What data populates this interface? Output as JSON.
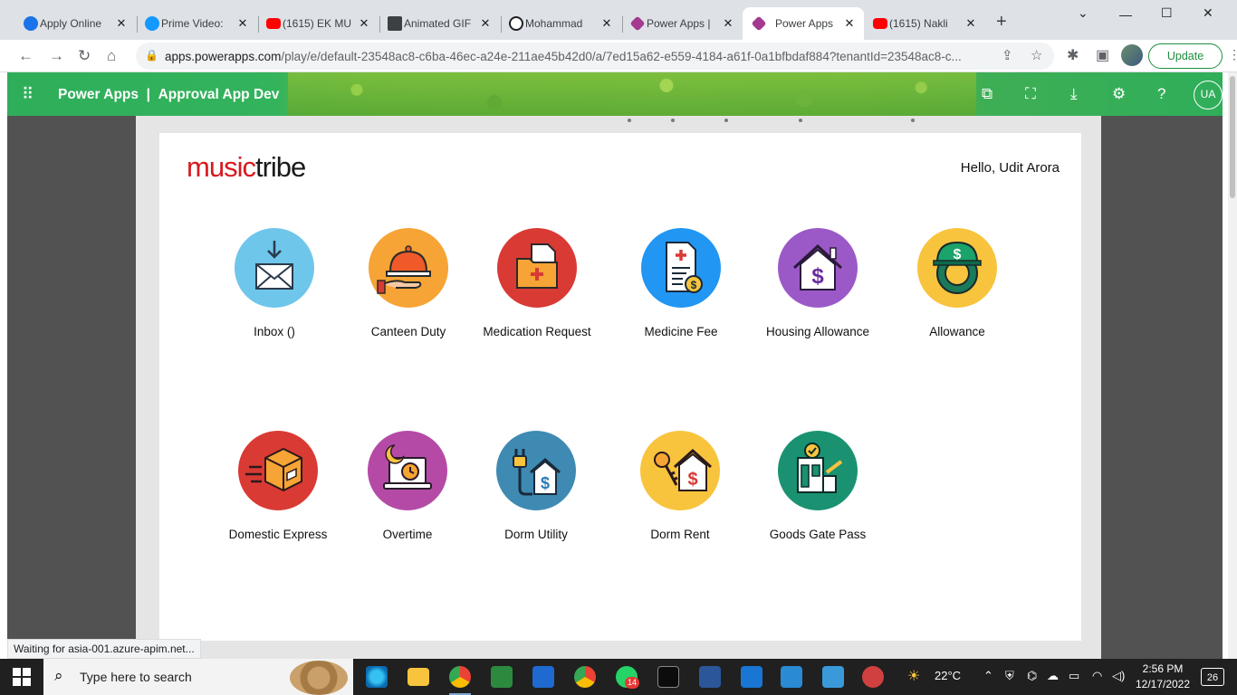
{
  "browser": {
    "tabs": [
      {
        "label": "Apply Online",
        "favicon_color": "#1a73e8"
      },
      {
        "label": "Prime Video:",
        "favicon_color": "#1399ff"
      },
      {
        "label": "(1615) EK MU",
        "favicon_color": "#ff0000"
      },
      {
        "label": "Animated GIF",
        "favicon_color": "#3c4043"
      },
      {
        "label": "Mohammad",
        "favicon_color": "#202124"
      },
      {
        "label": "Power Apps |",
        "favicon_color": "#a33a8f"
      },
      {
        "label": "Power Apps",
        "favicon_color": "#a33a8f",
        "active": true
      },
      {
        "label": "(1615) Nakli",
        "favicon_color": "#ff0000"
      }
    ],
    "url_host": "apps.powerapps.com",
    "url_path": "/play/e/default-23548ac8-c6ba-46ec-a24e-211ae45b42d0/a/7ed15a62-e559-4184-a61f-0a1bfbdaf884?tenantId=23548ac8-c...",
    "update_label": "Update",
    "status_text": "Waiting for asia-001.azure-apim.net..."
  },
  "powerapps": {
    "brand": "Power Apps",
    "separator": "|",
    "app_name": "Approval App Dev",
    "user_initials": "UA"
  },
  "app": {
    "logo_music": "music",
    "logo_tribe": "tribe",
    "greeting": "Hello, Udit Arora",
    "tiles": [
      {
        "label": "Inbox ()",
        "icon": "inbox-icon",
        "color": "#6ec6ea"
      },
      {
        "label": "Canteen Duty",
        "icon": "canteen-duty-icon",
        "color": "#f6a435"
      },
      {
        "label": "Medication Request",
        "icon": "medication-request-icon",
        "color": "#d93a34"
      },
      {
        "label": "Medicine Fee",
        "icon": "medicine-fee-icon",
        "color": "#2196f3"
      },
      {
        "label": "Housing Allowance",
        "icon": "housing-allowance-icon",
        "color": "#9b59c7"
      },
      {
        "label": "Allowance",
        "icon": "allowance-icon",
        "color": "#f8c43d"
      },
      {
        "label": "Domestic Express",
        "icon": "domestic-express-icon",
        "color": "#d93a34"
      },
      {
        "label": "Overtime",
        "icon": "overtime-icon",
        "color": "#b54aa6"
      },
      {
        "label": "Dorm Utility",
        "icon": "dorm-utility-icon",
        "color": "#3f8ab3"
      },
      {
        "label": "Dorm Rent",
        "icon": "dorm-rent-icon",
        "color": "#f8c43d"
      },
      {
        "label": "Goods Gate Pass",
        "icon": "goods-gate-pass-icon",
        "color": "#1a9272"
      }
    ]
  },
  "taskbar": {
    "search_placeholder": "Type here to search",
    "weather": "22°C",
    "time": "2:56 PM",
    "date": "12/17/2022",
    "notifications": "26",
    "whatsapp_badge": "14"
  }
}
